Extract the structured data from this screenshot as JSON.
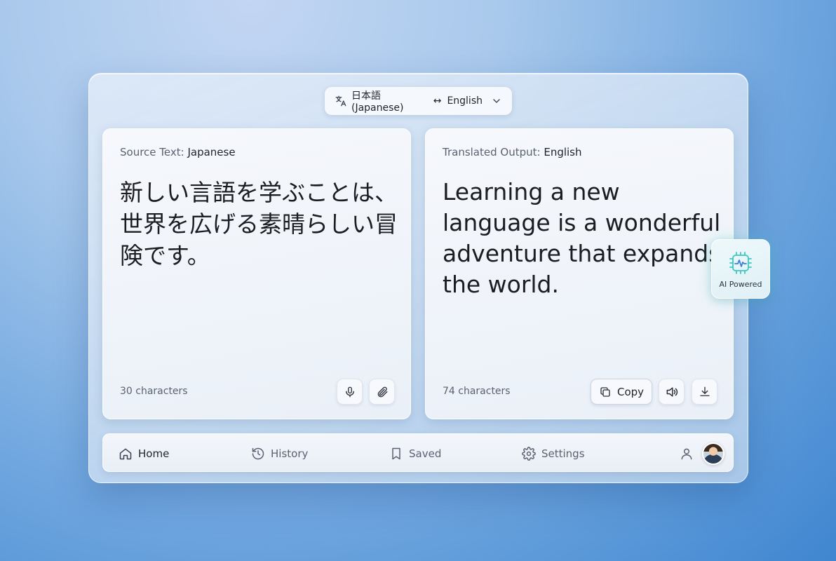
{
  "language_selector": {
    "source": "日本語 (Japanese)",
    "swap_symbol": "↔",
    "target": "English"
  },
  "source_panel": {
    "label_prefix": "Source Text:",
    "label_lang": "Japanese",
    "text": "新しい言語を学ぶことは、世界を広げる素晴らしい冒険です。",
    "char_count": "30 characters"
  },
  "output_panel": {
    "label_prefix": "Translated Output:",
    "label_lang": "English",
    "text": "Learning a new language is a wonderful adventure that expands the world.",
    "char_count": "74 characters",
    "copy_label": "Copy"
  },
  "ai_badge": {
    "label": "AI Powered",
    "accent": "#3cc9c0"
  },
  "nav": {
    "items": [
      {
        "label": "Home",
        "icon": "home-icon"
      },
      {
        "label": "History",
        "icon": "history-icon"
      },
      {
        "label": "Saved",
        "icon": "bookmark-icon"
      },
      {
        "label": "Settings",
        "icon": "gear-icon"
      }
    ],
    "active": "Home"
  }
}
